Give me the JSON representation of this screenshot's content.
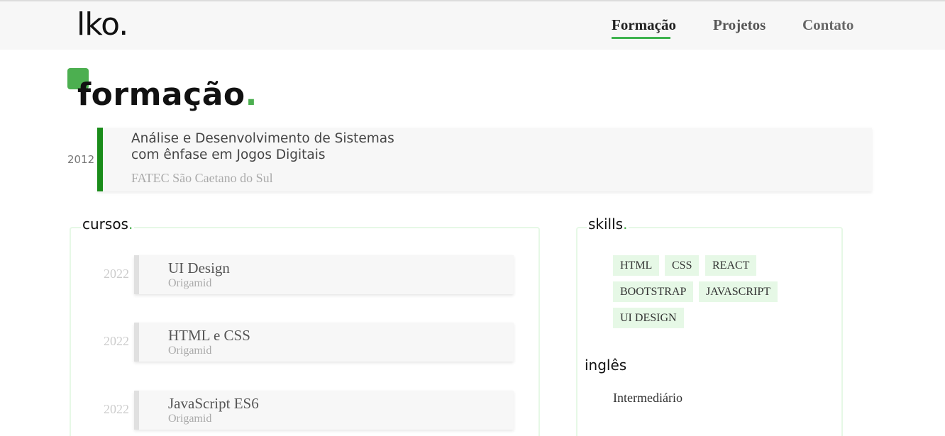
{
  "header": {
    "logo": "lko",
    "logo_dot": ".",
    "nav": [
      "Formação",
      "Projetos",
      "Contato"
    ]
  },
  "page": {
    "title": "formação",
    "title_dot": "."
  },
  "education": {
    "year": "2012",
    "title_line1": "Análise e Desenvolvimento de Sistemas",
    "title_line2": "com ênfase em Jogos Digitais",
    "school": "FATEC São Caetano do Sul"
  },
  "cursos": {
    "title": "cursos",
    "dot": ".",
    "items": [
      {
        "year": "2022",
        "name": "UI Design",
        "school": "Origamid"
      },
      {
        "year": "2022",
        "name": "HTML e CSS",
        "school": "Origamid"
      },
      {
        "year": "2022",
        "name": "JavaScript ES6",
        "school": "Origamid"
      }
    ]
  },
  "skills": {
    "title": "skills",
    "dot": ".",
    "tags": [
      "HTML",
      "CSS",
      "REACT",
      "BOOTSTRAP",
      "JAVASCRIPT",
      "UI DESIGN"
    ]
  },
  "ingles": {
    "title": "inglês",
    "level": "Intermediário"
  },
  "colors": {
    "accent": "#4caf50",
    "edu_border": "#1a8c1a",
    "tag_bg": "#e6f8e6"
  }
}
